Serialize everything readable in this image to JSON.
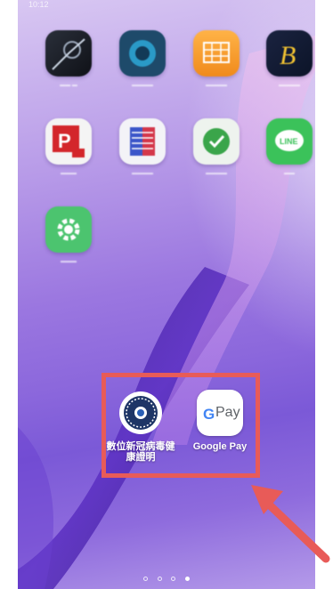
{
  "status_bar": {
    "time": "10:12",
    "right": ""
  },
  "home_apps": [
    {
      "label": "",
      "icon": "dark-camera-app-icon"
    },
    {
      "label": "",
      "icon": "blue-circle-app-icon"
    },
    {
      "label": "",
      "icon": "orange-grid-app-icon"
    },
    {
      "label": "",
      "icon": "yellow-b-app-icon"
    },
    {
      "label": "",
      "icon": "red-p-app-icon"
    },
    {
      "label": "",
      "icon": "book-app-icon"
    },
    {
      "label": "",
      "icon": "green-check-app-icon"
    },
    {
      "label": "",
      "icon": "line-app-icon"
    },
    {
      "label": "",
      "icon": "settings-gear-app-icon"
    }
  ],
  "highlighted_apps": [
    {
      "label": "數位新冠病毒健康證明",
      "label_line1": "數位新冠病毒健",
      "label_line2": "康證明",
      "icon": "covid-certificate-icon"
    },
    {
      "label": "Google Pay",
      "icon": "google-pay-icon",
      "icon_text": "Pay"
    }
  ],
  "page_indicator": {
    "pages": 4,
    "current": 4
  },
  "colors": {
    "highlight": "#e85b58",
    "arrow": "#e85b58",
    "line_green": "#3bc25a",
    "settings_green": "#4cc46f"
  }
}
